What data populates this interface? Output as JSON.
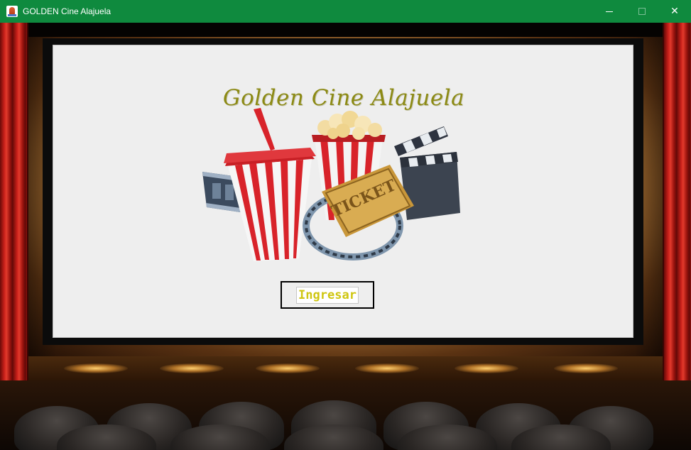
{
  "window": {
    "title": "GOLDEN Cine Alajuela",
    "controls": {
      "minimize_icon": "minimize-icon",
      "maximize_icon": "maximize-icon",
      "close_icon": "close-icon"
    },
    "close_glyph": "✕"
  },
  "screen": {
    "title": "Golden Cine Alajuela",
    "illustration": {
      "ticket_text": "TICKET",
      "description_icons": [
        "soda-cup-icon",
        "popcorn-icon",
        "film-strip-icon",
        "clapperboard-icon",
        "ticket-icon"
      ]
    },
    "enter_button": {
      "label": "Ingresar"
    }
  },
  "colors": {
    "titlebar": "#0f8a3e",
    "title_text": "#8c8a14",
    "button_text": "#cfc610",
    "screen_bg": "#eeeeee"
  }
}
